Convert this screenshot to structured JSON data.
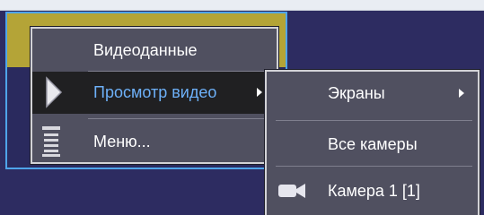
{
  "main_menu": {
    "items": [
      {
        "label": "Видеоданные"
      },
      {
        "label": "Просмотр видео"
      },
      {
        "label": "Меню..."
      }
    ]
  },
  "sub_menu": {
    "items": [
      {
        "label": "Экраны"
      },
      {
        "label": "Все камеры"
      },
      {
        "label": "Камера 1 [1]"
      }
    ]
  },
  "icons": {
    "play": "play-triangle-icon",
    "submenu_arrow": "chevron-right-icon",
    "menu": "menu-list-icon",
    "camera": "video-camera-icon"
  },
  "colors": {
    "menu_background": "#505060",
    "highlight_background": "#202022",
    "highlight_text": "#6db0f8",
    "desktop": "#2d2c61",
    "tile_border": "#4fa4ea",
    "tile_olive": "#b4a437"
  }
}
